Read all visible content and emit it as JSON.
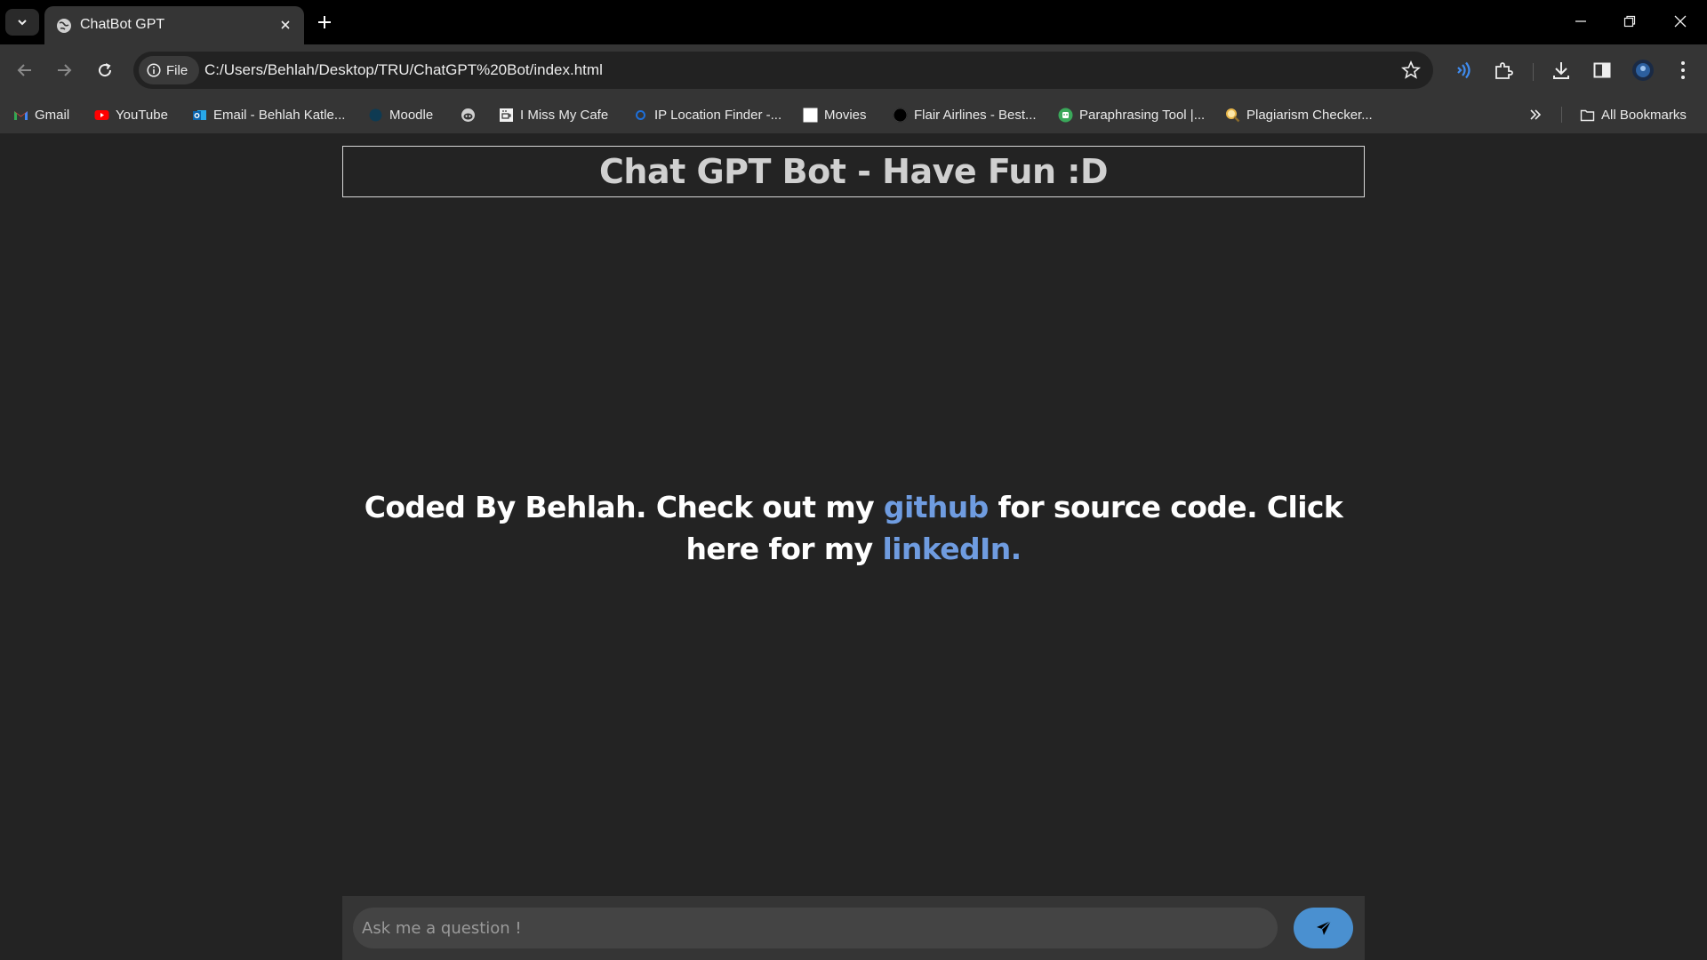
{
  "browser": {
    "tab": {
      "title": "ChatBot GPT"
    },
    "address": {
      "scheme_chip": "File",
      "url": "C:/Users/Behlah/Desktop/TRU/ChatGPT%20Bot/index.html"
    },
    "bookmarks": [
      {
        "label": "Gmail",
        "icon": "gmail-icon"
      },
      {
        "label": "YouTube",
        "icon": "youtube-icon"
      },
      {
        "label": "Email - Behlah Katle...",
        "icon": "outlook-icon"
      },
      {
        "label": "Moodle",
        "icon": "moodle-icon"
      },
      {
        "label": "",
        "icon": "reddit-icon"
      },
      {
        "label": "I Miss My Cafe",
        "icon": "cafe-icon"
      },
      {
        "label": "IP Location Finder -...",
        "icon": "ip-icon"
      },
      {
        "label": "Movies",
        "icon": "movies-icon"
      },
      {
        "label": "Flair Airlines - Best...",
        "icon": "flair-icon"
      },
      {
        "label": "Paraphrasing Tool |...",
        "icon": "paraphrasing-icon"
      },
      {
        "label": "Plagiarism Checker...",
        "icon": "magnifier-icon"
      }
    ],
    "all_bookmarks_label": "All Bookmarks"
  },
  "page": {
    "header_title": "Chat GPT Bot - Have Fun :D",
    "credit": {
      "part1": "Coded By Behlah. Check out my ",
      "github_link": "github",
      "part2": " for source code. Click here for my ",
      "linkedin_link": "linkedIn."
    },
    "input_placeholder": "Ask me a question !",
    "colors": {
      "link": "#6f9ce0",
      "send_button": "#4a90d0",
      "background": "#232323"
    }
  }
}
